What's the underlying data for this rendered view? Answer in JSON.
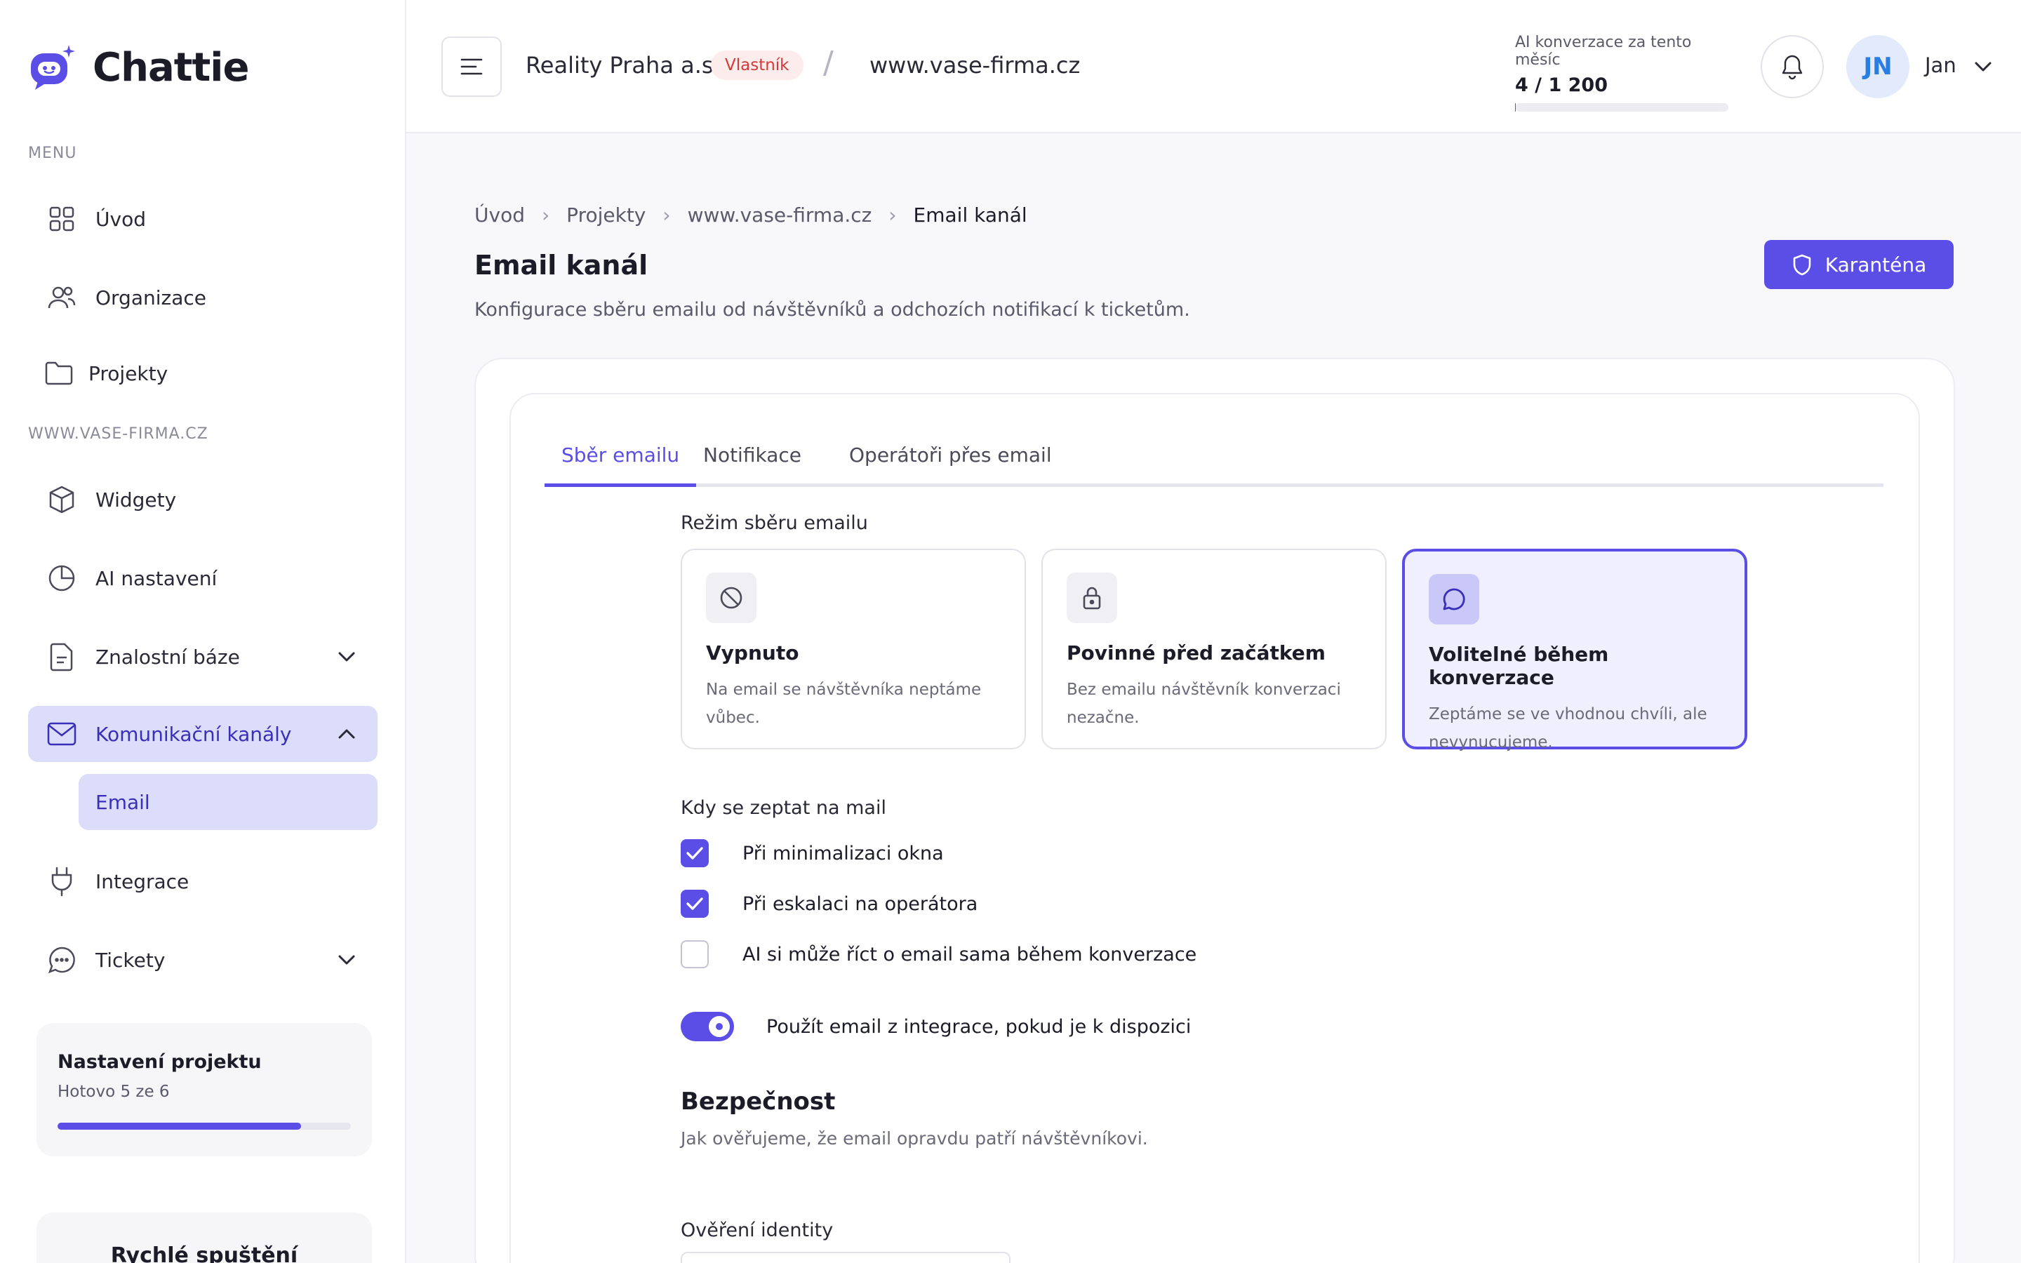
{
  "brand": {
    "name": "Chattie",
    "accent": "#5b4ee6"
  },
  "sidebar": {
    "menu_label": "MENU",
    "project_label": "WWW.VASE-FIRMA.CZ",
    "items": [
      {
        "label": "Úvod",
        "icon": "grid-icon"
      },
      {
        "label": "Organizace",
        "icon": "users-icon"
      },
      {
        "label": "Projekty",
        "icon": "folder-icon"
      },
      {
        "label": "Widgety",
        "icon": "cube-icon"
      },
      {
        "label": "AI nastavení",
        "icon": "pie-chart-icon"
      },
      {
        "label": "Znalostní báze",
        "icon": "document-icon"
      },
      {
        "label": "Komunikační kanály",
        "icon": "mail-icon"
      },
      {
        "label": "Email"
      },
      {
        "label": "Integrace",
        "icon": "plug-icon"
      },
      {
        "label": "Tickety",
        "icon": "chat-dots-icon"
      }
    ],
    "setup_card": {
      "title": "Nastavení projektu",
      "subtitle": "Hotovo 5 ze 6",
      "progress": 0.83
    },
    "quick_card": {
      "title": "Rychlé spuštění"
    }
  },
  "header": {
    "org_name": "Reality Praha a.s.",
    "role_badge": "Vlastník",
    "separator": "/",
    "site_name": "www.vase-firma.cz",
    "usage": {
      "label": "AI konverzace za tento měsíc",
      "value": "4 / 1 200",
      "fraction": 0.003
    },
    "avatar_initials": "JN",
    "user_name": "Jan"
  },
  "breadcrumb": [
    "Úvod",
    "Projekty",
    "www.vase-firma.cz",
    "Email kanál"
  ],
  "page": {
    "title": "Email kanál",
    "subtitle": "Konfigurace sběru emailu od návštěvníků a odchozích notifikací k ticketům.",
    "quarantine_button": "Karanténa"
  },
  "tabs": [
    "Sběr emailu",
    "Notifikace",
    "Operátoři přes email"
  ],
  "collection_mode": {
    "label": "Režim sběru emailu",
    "options": [
      {
        "title": "Vypnuto",
        "desc": "Na email se návštěvníka neptáme vůbec.",
        "icon": "ban-icon",
        "selected": false
      },
      {
        "title": "Povinné před začátkem",
        "desc": "Bez emailu návštěvník konverzaci nezačne.",
        "icon": "lock-icon",
        "selected": false
      },
      {
        "title": "Volitelné během konverzace",
        "desc": "Zeptáme se ve vhodnou chvíli, ale nevynucujeme.",
        "icon": "chat-bubble-icon",
        "selected": true
      }
    ]
  },
  "when_to_ask": {
    "label": "Kdy se zeptat na mail",
    "options": [
      {
        "label": "Při minimalizaci okna",
        "checked": true
      },
      {
        "label": "Při eskalaci na operátora",
        "checked": true
      },
      {
        "label": "AI si může říct o email sama během konverzace",
        "checked": false
      }
    ]
  },
  "integration_toggle": {
    "label": "Použít email z integrace, pokud je k dispozici",
    "on": true
  },
  "security": {
    "title": "Bezpečnost",
    "subtitle": "Jak ověřujeme, že email opravdu patří návštěvníkovi.",
    "identity_label": "Ověření identity"
  }
}
